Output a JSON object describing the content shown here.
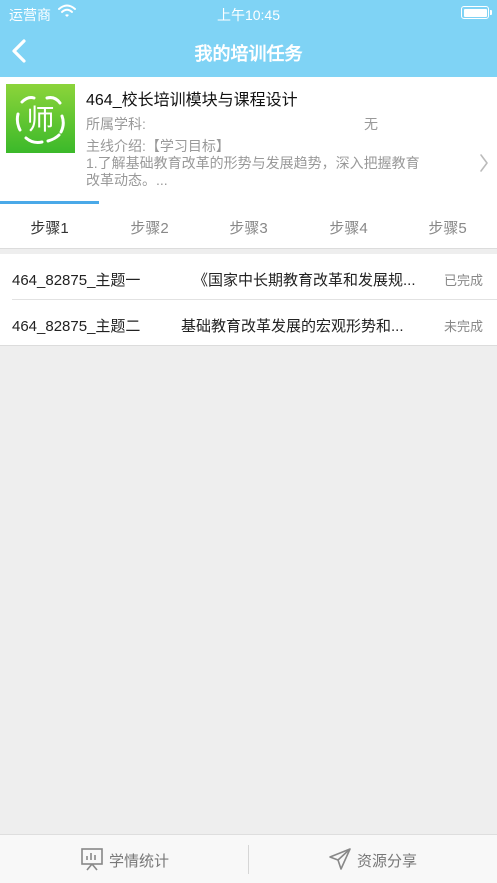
{
  "status_bar": {
    "carrier": "运营商",
    "time": "上午10:45"
  },
  "nav": {
    "title": "我的培训任务",
    "back_icon": "chevron-left-icon"
  },
  "course": {
    "logo_text": "师",
    "title": "464_校长培训模块与课程设计",
    "subject_label": "所属学科:",
    "subject_value": "无",
    "intro_line1": "主线介绍:【学习目标】",
    "intro_line2": "1.了解基础教育改革的形势与发展趋势，深入把握教育",
    "intro_line3": "改革动态。..."
  },
  "tabs": [
    {
      "label": "步骤1",
      "active": true
    },
    {
      "label": "步骤2",
      "active": false
    },
    {
      "label": "步骤3",
      "active": false
    },
    {
      "label": "步骤4",
      "active": false
    },
    {
      "label": "步骤5",
      "active": false
    }
  ],
  "topics": [
    {
      "name": "464_82875_主题一",
      "topic": "《国家中长期教育改革和发展规...",
      "status": "已完成"
    },
    {
      "name": "464_82875_主题二",
      "topic": "基础教育改革发展的宏观形势和...",
      "status": "未完成"
    }
  ],
  "bottom": {
    "stats_label": "学情统计",
    "stats_icon": "chart-icon",
    "share_label": "资源分享",
    "share_icon": "send-icon"
  }
}
